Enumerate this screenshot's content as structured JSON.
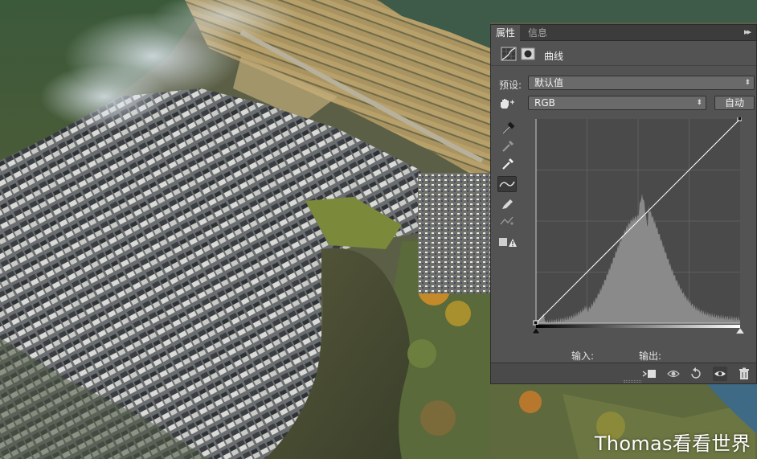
{
  "panel": {
    "tabs": [
      {
        "label": "属性",
        "active": true
      },
      {
        "label": "信息",
        "active": false
      }
    ],
    "collapse_glyph": "▸▸",
    "header_title": "曲线",
    "preset_label": "预设:",
    "preset_value": "默认值",
    "channel_value": "RGB",
    "auto_button": "自动",
    "input_label": "输入:",
    "output_label": "输出:",
    "tools": [
      "targeted-adjustment-hand-icon",
      "black-point-eyedropper-icon",
      "gray-point-eyedropper-icon",
      "white-point-eyedropper-icon",
      "curve-points-icon",
      "pencil-draw-icon",
      "smooth-curve-icon",
      "clipping-warning-icon"
    ],
    "footer_icons": [
      "clip-to-layer-icon",
      "view-previous-state-icon",
      "reset-icon",
      "visibility-eye-icon",
      "trash-icon"
    ]
  },
  "watermark": "Thomas看看世界",
  "colors": {
    "panel_bg": "#535353",
    "graph_bg": "#4a4a4a",
    "histogram": "#8a8a8a",
    "curve_line": "#ffffff"
  }
}
